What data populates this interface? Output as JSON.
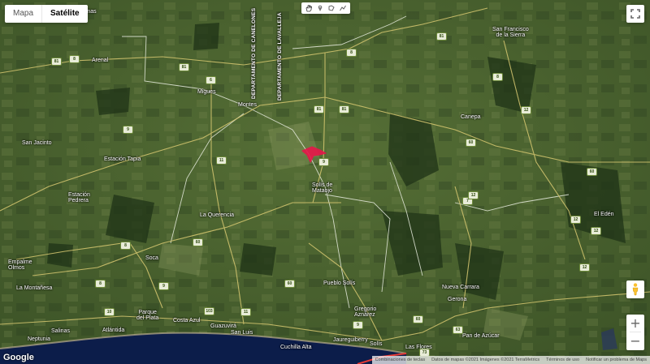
{
  "map_type": {
    "options": [
      "Mapa",
      "Satélite"
    ],
    "selected": "Satélite"
  },
  "drawing_tools": [
    "hand-icon",
    "marker-icon",
    "polygon-icon",
    "line-icon"
  ],
  "places": {
    "san_francisco": "San Francisco\nde la Sierra",
    "minas_top": "Minas",
    "arenal": "Arenal",
    "migues": "Migues",
    "montes": "Montes",
    "canepa": "Canepa",
    "san_jacinto": "San Jacinto",
    "estacion_tapia": "Estación Tapia",
    "estacion_pedrera": "Estación\nPedrera",
    "solis_mataojo": "Solís de\nMataojo",
    "la_querencia": "La Querencia",
    "el_edén": "El Edén",
    "empalme_olmos": "Empalme\nOlmos",
    "soca": "Soca",
    "pueblo_solis": "Pueblo Solís",
    "nueva_carrara": "Nueva Carrara",
    "la_montanesa": "La Montañesa",
    "gerona": "Gerona",
    "parque_plata": "Parque\ndel Plata",
    "costa_azul": "Costa Azul",
    "gregorio_aznarez": "Gregorio\nAznárez",
    "guazuvira": "Guazuvirá",
    "san_luis": "San Luis",
    "neptunia": "Neptunia",
    "salinas": "Salinas",
    "atlantida": "Atlántida",
    "pan_azucar": "Pan de Azúcar",
    "cuchilla_alta": "Cuchilla Alta",
    "jaureguiberry": "Jaureguiberry",
    "solis": "Solís",
    "las_flores": "Las Flores"
  },
  "departments": {
    "canelones": "DEPARTAMENTO DE CANELONES",
    "lavalleja": "DEPARTAMENTO DE LAVALLEJA"
  },
  "route_shields": [
    "81",
    "8",
    "8",
    "81",
    "6",
    "81",
    "12",
    "9",
    "11",
    "60",
    "7",
    "8",
    "81",
    "9",
    "60",
    "12",
    "8",
    "60",
    "9",
    "60",
    "103",
    "11",
    "10",
    "12",
    "9",
    "60",
    "8",
    "12",
    "73",
    "63",
    "81",
    "12"
  ],
  "footer": {
    "shortcuts": "Combinaciones de teclas",
    "credits": "Datos de mapas ©2021 Imágenes ©2021 TerraMetrics",
    "terms": "Términos de uso",
    "report": "Notificar un problema de Maps"
  },
  "logo": "Google",
  "colors": {
    "terrain": "#4f6b33",
    "ocean": "#0c1d4a",
    "marker": "#e8164a",
    "border": "#e53935"
  },
  "icons": {
    "fullscreen": "fullscreen-icon",
    "pegman": "pegman-icon",
    "zoom_in": "+",
    "zoom_out": "−"
  }
}
